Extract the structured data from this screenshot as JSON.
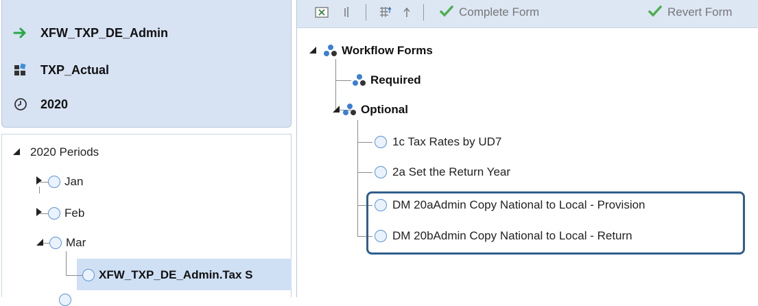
{
  "info": {
    "workflow": "XFW_TXP_DE_Admin",
    "scenario": "TXP_Actual",
    "time": "2020",
    "icons": [
      "arrow-right-icon",
      "cube-icon",
      "clock-icon"
    ],
    "colors": {
      "arrow": "#27a844",
      "panel_bg": "#d7e2f3"
    }
  },
  "periods_tree": {
    "root": "2020 Periods",
    "items": [
      "Jan",
      "Feb",
      "Mar"
    ],
    "selected": "XFW_TXP_DE_Admin.Tax S"
  },
  "toolbar": {
    "complete_label": "Complete Form",
    "revert_label": "Revert Form",
    "icons": [
      "excel-icon",
      "attach-icon",
      "grid-icon",
      "up-arrow-icon",
      "checkmark-icon",
      "checkmark-icon"
    ]
  },
  "forms_tree": {
    "root": "Workflow Forms",
    "required": "Required",
    "optional": "Optional",
    "items": [
      "1c Tax Rates by UD7",
      "2a Set the Return Year",
      "DM 20aAdmin Copy National to Local - Provision",
      "DM 20bAdmin Copy National to Local - Return"
    ],
    "highlight_color": "#2f5e8c"
  }
}
